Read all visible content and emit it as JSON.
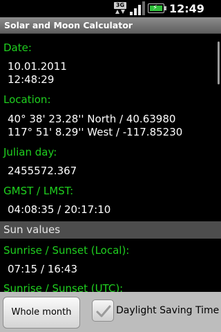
{
  "status_bar": {
    "network_label": "3G",
    "time": "12:49 PM",
    "battery_color": "#2fbf3a",
    "icons": [
      "network-3g-icon",
      "signal-icon",
      "battery-charging-icon"
    ]
  },
  "app": {
    "title": "Solar and Moon Calculator"
  },
  "fields": {
    "date": {
      "label": "Date:",
      "line1": "10.01.2011",
      "line2": "12:48:29"
    },
    "location": {
      "label": "Location:",
      "line1": "40° 38' 23.28'' North / 40.63980",
      "line2": "117° 51' 8.29'' West / -117.85230"
    },
    "julian_day": {
      "label": "Julian day:",
      "value": "2455572.367"
    },
    "gmst_lmst": {
      "label": "GMST / LMST:",
      "value": "04:08:35 / 20:17:10"
    }
  },
  "sun_section": {
    "header": "Sun values",
    "sunrise_local": {
      "label": "Sunrise / Sunset (Local):",
      "value": "07:15 / 16:43"
    },
    "sunrise_utc": {
      "label": "Sunrise / Sunset (UTC):"
    }
  },
  "bottom": {
    "whole_month_label": "Whole month",
    "dst_label": "Daylight Saving Time",
    "dst_checked": true
  },
  "colors": {
    "label_green": "#1fd01f",
    "section_bg": "#4d4d4d",
    "title_bar": "#7a7a7a"
  }
}
